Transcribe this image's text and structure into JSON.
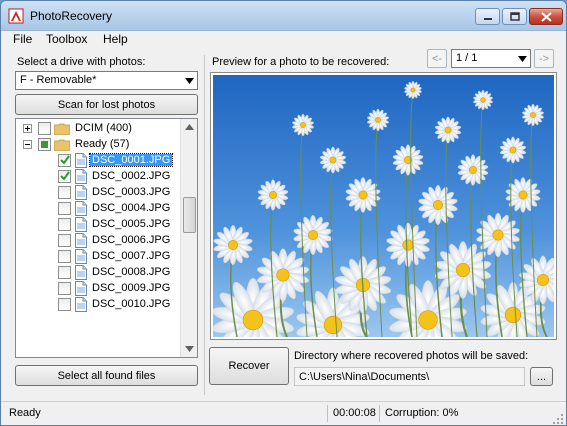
{
  "window": {
    "title": "PhotoRecovery"
  },
  "menu": [
    "File",
    "Toolbox",
    "Help"
  ],
  "left_panel": {
    "drive_label": "Select a drive with photos:",
    "drive_value": "F - Removable*",
    "scan_button": "Scan for lost photos",
    "select_all_button": "Select all found files",
    "tree": {
      "groups": [
        {
          "label": "DCIM",
          "count": "(400)",
          "expanded": false,
          "state": "unchecked"
        },
        {
          "label": "Ready",
          "count": "(57)",
          "expanded": true,
          "state": "partial"
        }
      ],
      "files": [
        {
          "name": "DSC_0001.JPG",
          "checked": true,
          "selected": true
        },
        {
          "name": "DSC_0002.JPG",
          "checked": true,
          "selected": false
        },
        {
          "name": "DSC_0003.JPG",
          "checked": false,
          "selected": false
        },
        {
          "name": "DSC_0004.JPG",
          "checked": false,
          "selected": false
        },
        {
          "name": "DSC_0005.JPG",
          "checked": false,
          "selected": false
        },
        {
          "name": "DSC_0006.JPG",
          "checked": false,
          "selected": false
        },
        {
          "name": "DSC_0007.JPG",
          "checked": false,
          "selected": false
        },
        {
          "name": "DSC_0008.JPG",
          "checked": false,
          "selected": false
        },
        {
          "name": "DSC_0009.JPG",
          "checked": false,
          "selected": false
        },
        {
          "name": "DSC_0010.JPG",
          "checked": false,
          "selected": false
        }
      ]
    }
  },
  "right_panel": {
    "preview_label": "Preview for a photo to be recovered:",
    "prev_button": "<-",
    "next_button": "->",
    "page_value": "1 / 1",
    "recover_button": "Recover",
    "directory_label": "Directory where recovered photos will be saved:",
    "directory_value": "C:\\Users\\Nina\\Documents\\",
    "browse_button": "..."
  },
  "status": {
    "state": "Ready",
    "time": "00:00:08",
    "corruption": "Corruption: 0%"
  },
  "colors": {
    "selection": "#3399ff",
    "check_green": "#2e9a2e",
    "sky": "#2f7fd0",
    "daisy_center": "#f3c21b"
  }
}
